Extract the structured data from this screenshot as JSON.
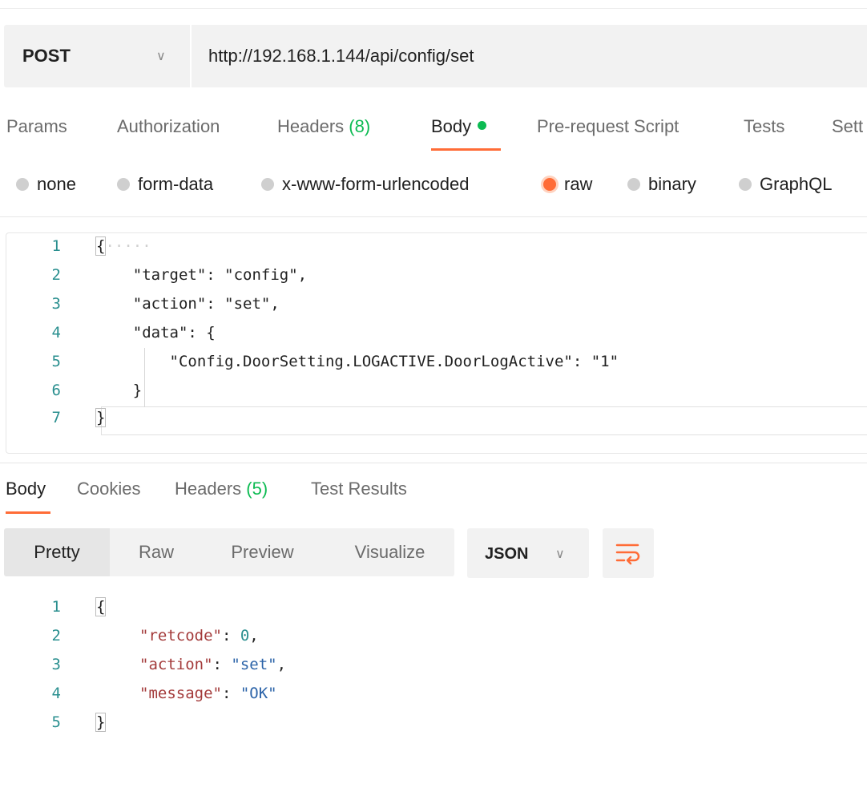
{
  "request": {
    "method": "POST",
    "url": "http://192.168.1.144/api/config/set"
  },
  "request_tabs": {
    "params": "Params",
    "authorization": "Authorization",
    "headers": "Headers",
    "headers_count": "(8)",
    "body": "Body",
    "pre_request": "Pre-request Script",
    "tests": "Tests",
    "settings": "Sett"
  },
  "body_types": {
    "none": "none",
    "form_data": "form-data",
    "urlencoded": "x-www-form-urlencoded",
    "raw": "raw",
    "binary": "binary",
    "graphql": "GraphQL",
    "selected": "raw"
  },
  "request_body": {
    "line_numbers": [
      "1",
      "2",
      "3",
      "4",
      "5",
      "6",
      "7"
    ],
    "lines": [
      "{",
      "    \"target\": \"config\",",
      "    \"action\": \"set\",",
      "    \"data\": {",
      "        \"Config.DoorSetting.LOGACTIVE.DoorLogActive\": \"1\"",
      "    }",
      "}"
    ]
  },
  "response_tabs": {
    "body": "Body",
    "cookies": "Cookies",
    "headers": "Headers",
    "headers_count": "(5)",
    "test_results": "Test Results"
  },
  "view_modes": {
    "pretty": "Pretty",
    "raw": "Raw",
    "preview": "Preview",
    "visualize": "Visualize",
    "selected": "Pretty"
  },
  "format": "JSON",
  "response_body": {
    "line_numbers": [
      "1",
      "2",
      "3",
      "4",
      "5"
    ],
    "open": "{",
    "retcode_key": "\"retcode\"",
    "retcode_value": "0",
    "action_key": "\"action\"",
    "action_value": "\"set\"",
    "message_key": "\"message\"",
    "message_value": "\"OK\"",
    "close": "}"
  },
  "colors": {
    "accent": "#ff6c37",
    "count_green": "#0cbb52",
    "json_key": "#a33a3a",
    "json_string": "#2b63a8",
    "line_number": "#2a8f8f"
  }
}
